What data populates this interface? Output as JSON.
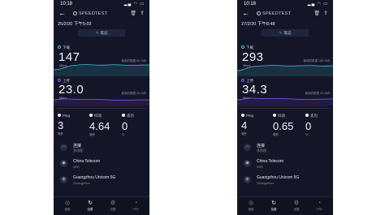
{
  "colors": {
    "background": "#141628",
    "download_accent": "#3ac6d9",
    "upload_accent": "#8a5cf6"
  },
  "screens": [
    {
      "status_time": "10:18",
      "app_name": "SPEEDTEST",
      "datetime": "25/2/20 下午5:03",
      "note_label": "笔记",
      "download": {
        "label": "下载",
        "value": "147",
        "unit": "Mbps",
        "used": "使用的数据 66.7MB"
      },
      "upload": {
        "label": "上传",
        "value": "23.0",
        "unit": "Mbps",
        "used": "使用的数据 20.2MB"
      },
      "ping": {
        "label": "Ping",
        "value": "3",
        "unit": "毫秒"
      },
      "jitter": {
        "label": "抖动",
        "value": "4.64",
        "unit": "毫秒"
      },
      "loss": {
        "label": "丢包",
        "value": "0",
        "unit": "%"
      },
      "connection": {
        "title": "连接",
        "sub": "多线程"
      },
      "network": {
        "title": "China Telecom",
        "sub": "WiFi"
      },
      "server": {
        "title": "Guangzhou Unicom 5G",
        "sub": "Guangzhou"
      }
    },
    {
      "status_time": "10:18",
      "app_name": "SPEEDTEST",
      "datetime": "27/2/20 下午8:48",
      "note_label": "笔记",
      "download": {
        "label": "下载",
        "value": "293",
        "unit": "Mbps",
        "used": "使用的数据 185.2MB"
      },
      "upload": {
        "label": "上传",
        "value": "34.3",
        "unit": "Mbps",
        "used": "使用的数据 32.2MB"
      },
      "ping": {
        "label": "Ping",
        "value": "4",
        "unit": "毫秒"
      },
      "jitter": {
        "label": "抖动",
        "value": "0.65",
        "unit": "毫秒"
      },
      "loss": {
        "label": "丢包",
        "value": "0",
        "unit": "%"
      },
      "connection": {
        "title": "连接",
        "sub": "多线程"
      },
      "network": {
        "title": "China Telecom",
        "sub": "WiFi"
      },
      "server": {
        "title": "Guangzhou Unicom 5G",
        "sub": "Guangzhou"
      }
    }
  ],
  "tabs": [
    {
      "icon": "◎",
      "label": "速度"
    },
    {
      "icon": "↻",
      "label": "结果"
    },
    {
      "icon": "⚙",
      "label": "设置"
    },
    {
      "icon": "◔",
      "label": "VPN"
    }
  ]
}
